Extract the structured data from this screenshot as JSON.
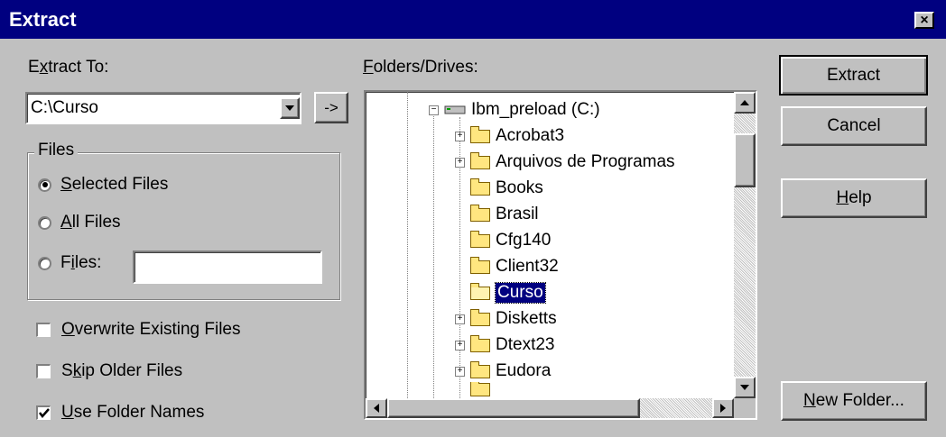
{
  "window": {
    "title": "Extract",
    "close_glyph": "×"
  },
  "extract_to": {
    "label_pre": "E",
    "label_ul": "x",
    "label_post": "tract To:",
    "value": "C:\\Curso",
    "arrow_label": "->"
  },
  "files_group": {
    "label": "Files",
    "options": [
      {
        "pre": "",
        "ul": "S",
        "post": "elected Files",
        "checked": true
      },
      {
        "pre": "",
        "ul": "A",
        "post": "ll Files",
        "checked": false
      },
      {
        "pre": "F",
        "ul": "i",
        "post": "les:",
        "checked": false
      }
    ],
    "files_input_value": ""
  },
  "checkboxes": [
    {
      "pre": "",
      "ul": "O",
      "post": "verwrite Existing Files",
      "checked": false
    },
    {
      "pre": "S",
      "ul": "k",
      "post": "ip Older Files",
      "checked": false
    },
    {
      "pre": "",
      "ul": "U",
      "post": "se Folder Names",
      "checked": true
    }
  ],
  "folders": {
    "label_pre": "",
    "label_ul": "F",
    "label_post": "olders/Drives:",
    "drive": "Ibm_preload (C:)",
    "items": [
      {
        "name": "Acrobat3",
        "expandable": true,
        "selected": false
      },
      {
        "name": "Arquivos de Programas",
        "expandable": true,
        "selected": false
      },
      {
        "name": "Books",
        "expandable": false,
        "selected": false
      },
      {
        "name": "Brasil",
        "expandable": false,
        "selected": false
      },
      {
        "name": "Cfg140",
        "expandable": false,
        "selected": false
      },
      {
        "name": "Client32",
        "expandable": false,
        "selected": false
      },
      {
        "name": "Curso",
        "expandable": false,
        "selected": true
      },
      {
        "name": "Disketts",
        "expandable": true,
        "selected": false
      },
      {
        "name": "Dtext23",
        "expandable": true,
        "selected": false
      },
      {
        "name": "Eudora",
        "expandable": true,
        "selected": false
      }
    ]
  },
  "buttons": {
    "extract": "Extract",
    "cancel": "Cancel",
    "help_ul": "H",
    "help_post": "elp",
    "new_folder_ul": "N",
    "new_folder_post": "ew Folder..."
  }
}
